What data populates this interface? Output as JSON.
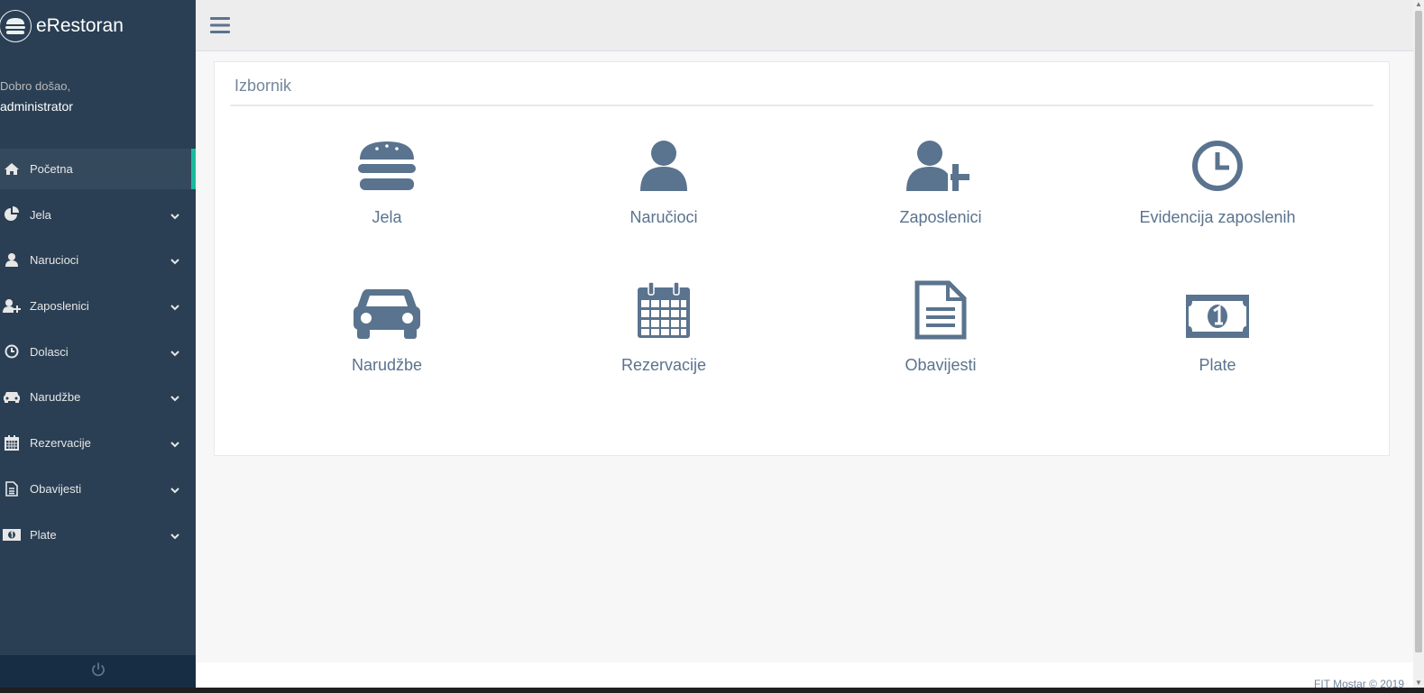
{
  "brand": {
    "title": "eRestoran",
    "icon": "burger-icon"
  },
  "welcome": {
    "greeting": "Dobro došao,",
    "username": "administrator"
  },
  "menu": [
    {
      "label": "Početna",
      "icon": "home-icon",
      "active": true
    },
    {
      "label": "Jela",
      "icon": "pie-chart-icon"
    },
    {
      "label": "Narucioci",
      "icon": "user-icon"
    },
    {
      "label": "Zaposlenici",
      "icon": "user-plus-icon"
    },
    {
      "label": "Dolasci",
      "icon": "clock-icon"
    },
    {
      "label": "Narudžbe",
      "icon": "car-icon"
    },
    {
      "label": "Rezervacije",
      "icon": "calendar-icon"
    },
    {
      "label": "Obavijesti",
      "icon": "document-icon"
    },
    {
      "label": "Plate",
      "icon": "money-icon"
    }
  ],
  "panel": {
    "title": "Izbornik",
    "tiles": [
      {
        "label": "Jela",
        "icon": "burger-icon"
      },
      {
        "label": "Naručioci",
        "icon": "user-icon"
      },
      {
        "label": "Zaposlenici",
        "icon": "user-plus-icon"
      },
      {
        "label": "Evidencija zaposlenih",
        "icon": "clock-icon"
      },
      {
        "label": "Narudžbe",
        "icon": "car-icon"
      },
      {
        "label": "Rezervacije",
        "icon": "calendar-icon"
      },
      {
        "label": "Obavijesti",
        "icon": "document-icon"
      },
      {
        "label": "Plate",
        "icon": "money-icon"
      }
    ]
  },
  "footer": {
    "text": "FIT Mostar © 2019"
  },
  "colors": {
    "sidebar": "#2a3f54",
    "accent": "#1abb9c",
    "icon": "#5a738e"
  }
}
